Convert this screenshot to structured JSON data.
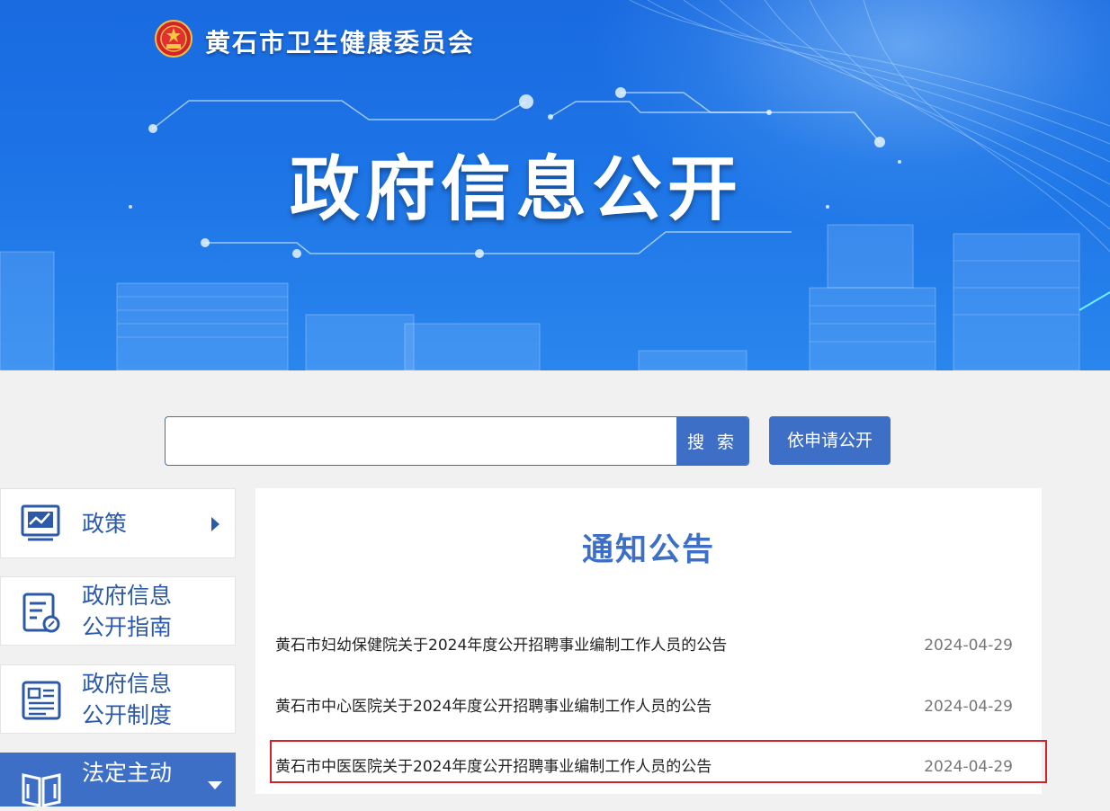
{
  "header": {
    "org_name": "黄石市卫生健康委员会",
    "banner_title": "政府信息公开"
  },
  "search": {
    "placeholder": "",
    "button_label": "搜 索",
    "apply_label": "依申请公开"
  },
  "sidebar": {
    "items": [
      {
        "label": "政策",
        "icon": "chart-board-icon",
        "state": "collapsed"
      },
      {
        "label": "政府信息\n公开指南",
        "icon": "guide-document-icon",
        "state": "normal"
      },
      {
        "label": "政府信息\n公开制度",
        "icon": "regulation-document-icon",
        "state": "normal"
      },
      {
        "label": "法定主动",
        "icon": "open-book-icon",
        "state": "expanded"
      }
    ]
  },
  "main": {
    "section_title": "通知公告",
    "notices": [
      {
        "title": "黄石市妇幼保健院关于2024年度公开招聘事业编制工作人员的公告",
        "date": "2024-04-29"
      },
      {
        "title": "黄石市中心医院关于2024年度公开招聘事业编制工作人员的公告",
        "date": "2024-04-29"
      },
      {
        "title": "黄石市中医医院关于2024年度公开招聘事业编制工作人员的公告",
        "date": "2024-04-29",
        "highlighted": true
      }
    ]
  },
  "colors": {
    "accent": "#3e6fc6",
    "banner": "#1d74e6",
    "highlight": "#d4222a",
    "background": "#f1f1f1"
  }
}
